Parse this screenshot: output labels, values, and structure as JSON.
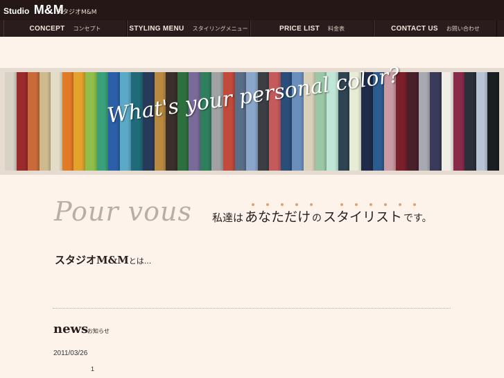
{
  "header": {
    "brand_small": "Studio",
    "brand_large": "M&M",
    "brand_jp": "スタジオM&M"
  },
  "nav": [
    {
      "en": "CONCEPT",
      "jp": "コンセプト"
    },
    {
      "en": "STYLING MENU",
      "jp": "スタイリングメニュー"
    },
    {
      "en": "PRICE LIST",
      "jp": "料金表"
    },
    {
      "en": "CONTACT US",
      "jp": "お問い合わせ"
    }
  ],
  "banner": {
    "text": "What's your personal color?",
    "swatch_colors": [
      "#d8d2c4",
      "#9a2b2c",
      "#c86a3a",
      "#cdbb8f",
      "#e3dcc6",
      "#e27b26",
      "#e2a22c",
      "#8fbf4a",
      "#39a07a",
      "#2b5fa8",
      "#5aa9c6",
      "#1f6b7a",
      "#263a5a",
      "#b9893f",
      "#3a2f2a",
      "#2d6f3e",
      "#7a6a9a",
      "#2f7e5c",
      "#9fa1a3",
      "#c24a3b",
      "#5a6e88",
      "#8aa6c9",
      "#3b3f44",
      "#c55a5c",
      "#2a4d7a",
      "#6a8fbd",
      "#d8d0b9",
      "#9ac7a6",
      "#bfe6d6",
      "#2e4452",
      "#e7ecd6",
      "#1e2b4a",
      "#2c5c8e",
      "#c89aa4",
      "#7b1f2a",
      "#4a1f2c",
      "#a8a9b0",
      "#3a3a5a",
      "#f0eee6",
      "#8a2a4a",
      "#2b2f3a",
      "#b7c4d6",
      "#1a1f22"
    ]
  },
  "pour": {
    "title": "Pour vous"
  },
  "slogan": {
    "part1": "私達は",
    "part2": "あなただけ",
    "part3": "の",
    "part4": "スタイリスト",
    "part5": "です。",
    "dot_color": "#e3a06f"
  },
  "about": {
    "title": "スタジオM&M",
    "suffix": "とは..."
  },
  "news": {
    "title": "news",
    "jp": "お知らせ",
    "date": "2011/03/26",
    "count": "1"
  }
}
